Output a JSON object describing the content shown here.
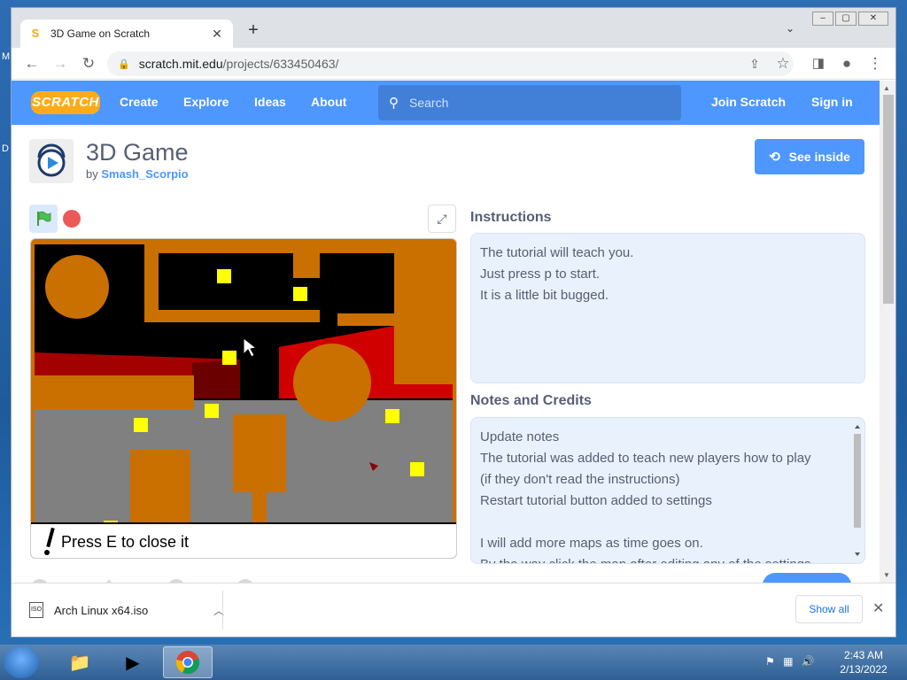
{
  "desktop": {
    "left_labels": [
      "M",
      "D"
    ]
  },
  "browser": {
    "tab_title": "3D Game on Scratch",
    "url_host": "scratch.mit.edu",
    "url_path": "/projects/633450463/"
  },
  "nav": {
    "logo": "SCRATCH",
    "links": [
      "Create",
      "Explore",
      "Ideas",
      "About"
    ],
    "search_placeholder": "Search",
    "join": "Join Scratch",
    "signin": "Sign in"
  },
  "project": {
    "title": "3D Game",
    "by_label": "by",
    "author": "Smash_Scorpio",
    "see_inside": "See inside"
  },
  "stage": {
    "dialog_text": "Press E to close it"
  },
  "instructions": {
    "heading": "Instructions",
    "lines": [
      "The tutorial will teach you.",
      "Just press p to start.",
      "It is a little bit bugged."
    ]
  },
  "notes": {
    "heading": "Notes and Credits",
    "lines": [
      "Update notes",
      "The tutorial was added to teach new players how to play",
      "(if they don't read the instructions)",
      "Restart tutorial button added to settings",
      "",
      "I will add more maps as time goes on.",
      "By the way click the map after editing any of the settings"
    ]
  },
  "downloads": {
    "file": "Arch Linux x64.iso",
    "show_all": "Show all"
  },
  "taskbar": {
    "time": "2:43 AM",
    "date": "2/13/2022"
  }
}
